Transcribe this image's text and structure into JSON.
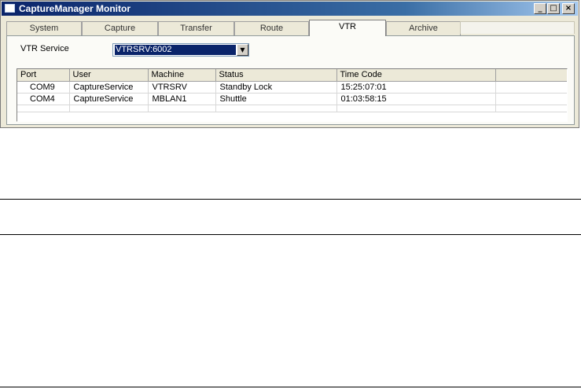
{
  "window": {
    "title": "CaptureManager Monitor",
    "controls": {
      "minimize": "_",
      "maximize": "□",
      "close": "×"
    }
  },
  "tabs": [
    {
      "label": "System",
      "active": false
    },
    {
      "label": "Capture",
      "active": false
    },
    {
      "label": "Transfer",
      "active": false
    },
    {
      "label": "Route",
      "active": false
    },
    {
      "label": "VTR",
      "active": true
    },
    {
      "label": "Archive",
      "active": false
    }
  ],
  "vtr": {
    "service_label": "VTR Service",
    "service_value": "VTRSRV:6002",
    "dropdown_icon": "▼"
  },
  "table": {
    "columns": [
      "Port",
      "User",
      "Machine",
      "Status",
      "Time Code",
      ""
    ],
    "rows": [
      [
        "COM9",
        "CaptureService",
        "VTRSRV",
        "Standby Lock",
        "15:25:07:01",
        ""
      ],
      [
        "COM4",
        "CaptureService",
        "MBLAN1",
        "Shuttle",
        "01:03:58:15",
        ""
      ]
    ]
  },
  "colors": {
    "title_bar": "#0a246a",
    "selection": "#0a246a",
    "panel": "#fbfbf7"
  }
}
